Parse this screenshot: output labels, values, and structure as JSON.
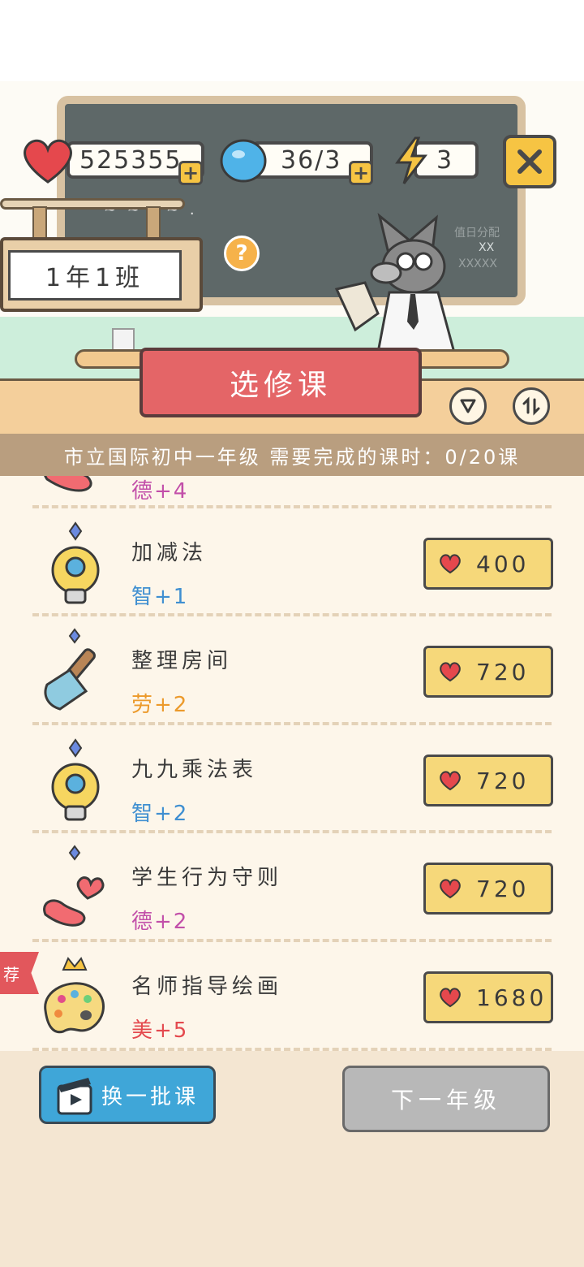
{
  "resources": {
    "hearts": "525355",
    "gems": "36/3",
    "energy": "3"
  },
  "classroom": {
    "class_label": "1年1班",
    "chalkboard_lines": [
      "值日分配",
      "XX",
      "XXXXX"
    ]
  },
  "panel": {
    "title": "选修课",
    "progress_text": "市立国际初中一年级 需要完成的课时：0/20课"
  },
  "courses": [
    {
      "name": "",
      "stat": "德+4",
      "stat_color": "#c24fa9",
      "icon": "hearts-icon",
      "price": ""
    },
    {
      "name": "加减法",
      "stat": "智+1",
      "stat_color": "#3f8fd1",
      "icon": "lightbulb-icon",
      "price": "400"
    },
    {
      "name": "整理房间",
      "stat": "劳+2",
      "stat_color": "#ec9a2b",
      "icon": "shovel-icon",
      "price": "720"
    },
    {
      "name": "九九乘法表",
      "stat": "智+2",
      "stat_color": "#3f8fd1",
      "icon": "lightbulb-icon",
      "price": "720"
    },
    {
      "name": "学生行为守则",
      "stat": "德+2",
      "stat_color": "#c24fa9",
      "icon": "hearts-icon",
      "price": "720"
    },
    {
      "name": "名师指导绘画",
      "stat": "美+5",
      "stat_color": "#e4494e",
      "icon": "palette-icon",
      "price": "1680",
      "recommended": "荐"
    }
  ],
  "buttons": {
    "refresh": "换一批课",
    "next_grade": "下一年级"
  },
  "colors": {
    "heart_red": "#e5484d",
    "button_yellow": "#f6d87a",
    "title_red": "#e46567",
    "refresh_blue": "#3fa6d8",
    "disabled_gray": "#b8b8b8"
  }
}
